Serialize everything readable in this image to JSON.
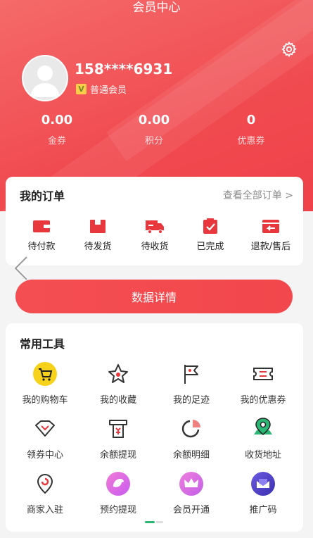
{
  "header": {
    "title": "会员中心"
  },
  "profile": {
    "phone": "158****6931",
    "level": "普通会员",
    "level_badge": "V"
  },
  "stats": [
    {
      "value": "0.00",
      "label": "金券"
    },
    {
      "value": "0.00",
      "label": "积分"
    },
    {
      "value": "0",
      "label": "优惠券"
    }
  ],
  "orders": {
    "title": "我的订单",
    "view_all": "查看全部订单 >",
    "items": [
      {
        "label": "待付款",
        "icon": "wallet-icon"
      },
      {
        "label": "待发货",
        "icon": "package-icon"
      },
      {
        "label": "待收货",
        "icon": "truck-icon"
      },
      {
        "label": "已完成",
        "icon": "clipboard-check-icon"
      },
      {
        "label": "退款/售后",
        "icon": "return-icon"
      }
    ]
  },
  "data_button": "数据详情",
  "tools": {
    "title": "常用工具",
    "items": [
      {
        "label": "我的购物车",
        "icon": "cart-icon"
      },
      {
        "label": "我的收藏",
        "icon": "star-icon"
      },
      {
        "label": "我的足迹",
        "icon": "flag-icon"
      },
      {
        "label": "我的优惠券",
        "icon": "coupon-icon"
      },
      {
        "label": "领券中心",
        "icon": "diamond-icon"
      },
      {
        "label": "余额提现",
        "icon": "withdraw-icon"
      },
      {
        "label": "余额明细",
        "icon": "pie-icon"
      },
      {
        "label": "收货地址",
        "icon": "location-icon"
      },
      {
        "label": "商家入驻",
        "icon": "store-pin-icon"
      },
      {
        "label": "预约提现",
        "icon": "bird-icon"
      },
      {
        "label": "会员开通",
        "icon": "crown-icon"
      },
      {
        "label": "推广码",
        "icon": "qr-promo-icon"
      }
    ]
  },
  "colors": {
    "brand": "#f04a4f",
    "accent_green": "#2bb673",
    "cart_yellow": "#f6d31a"
  }
}
